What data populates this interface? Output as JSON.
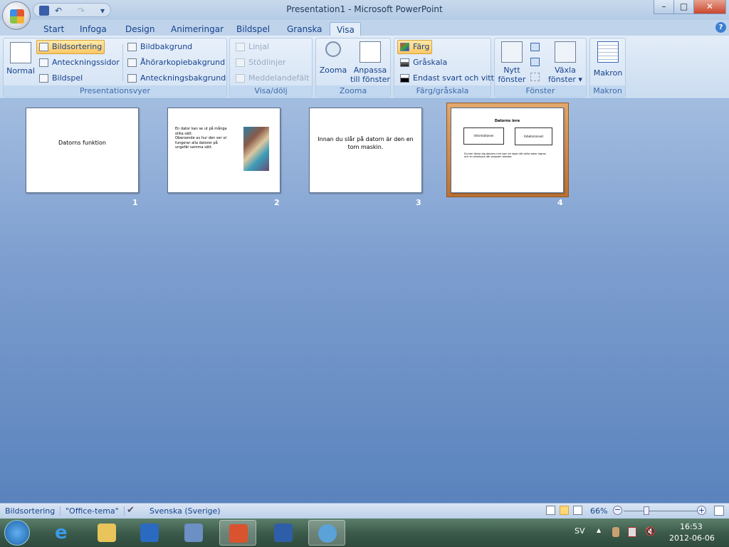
{
  "window": {
    "title": "Presentation1 - Microsoft PowerPoint",
    "minimize": "–",
    "maximize": "□",
    "close": "✕"
  },
  "qat": {
    "save": "save-icon",
    "undo": "↶",
    "redo": "↷",
    "customize": "▾"
  },
  "tabs": [
    "Start",
    "Infoga",
    "Design",
    "Animeringar",
    "Bildspel",
    "Granska",
    "Visa"
  ],
  "active_tab": "Visa",
  "help": "?",
  "ribbon": {
    "presentationsvyer": {
      "label": "Presentationsvyer",
      "normal": "Normal",
      "bildsortering": "Bildsortering",
      "anteckningssidor": "Anteckningssidor",
      "bildspel": "Bildspel",
      "bildbakgrund": "Bildbakgrund",
      "ahorarkopiebakgrund": "Åhörarkopiebakgrund",
      "anteckningsbakgrund": "Anteckningsbakgrund"
    },
    "visadolj": {
      "label": "Visa/dölj",
      "linjal": "Linjal",
      "stodlinjer": "Stödlinjer",
      "meddelandefalt": "Meddelandefält"
    },
    "zooma": {
      "label": "Zooma",
      "zooma": "Zooma",
      "anpassa1": "Anpassa",
      "anpassa2": "till fönster"
    },
    "farg": {
      "label": "Färg/gråskala",
      "farg": "Färg",
      "graskala": "Gråskala",
      "svartvitt": "Endast svart och vitt"
    },
    "fonster": {
      "label": "Fönster",
      "nytt1": "Nytt",
      "nytt2": "fönster",
      "vaxla1": "Växla",
      "vaxla2": "fönster ▾"
    },
    "makron": {
      "label": "Makron",
      "makron": "Makron"
    }
  },
  "slides": [
    {
      "num": "1",
      "title": "Datorns funktion"
    },
    {
      "num": "2",
      "lines": [
        "En dator kan se ut på många olika sätt.",
        "Oberoende av hur den ser ut fungerar alla datorer på ungefär samma sätt."
      ]
    },
    {
      "num": "3",
      "title": "Innan du slår på datorn är den en tom maskin."
    },
    {
      "num": "4",
      "title": "Datorns inre",
      "box1": "Informationen",
      "box2": "Arbetsminnet",
      "body": "Du kan tänka dig datorns inre som en lager där olika saker lagras och en arbetsyta där program arbetar."
    }
  ],
  "selected_slide": "4",
  "status": {
    "view": "Bildsortering",
    "theme": "\"Office-tema\"",
    "language": "Svenska (Sverige)",
    "zoom": "66%",
    "zoom_percent": 66
  },
  "taskbar": {
    "lang": "SV",
    "time": "16:53",
    "date": "2012-06-06",
    "apps": [
      "start",
      "internet-explorer",
      "explorer",
      "media-player",
      "paint",
      "powerpoint",
      "word",
      "other"
    ]
  }
}
